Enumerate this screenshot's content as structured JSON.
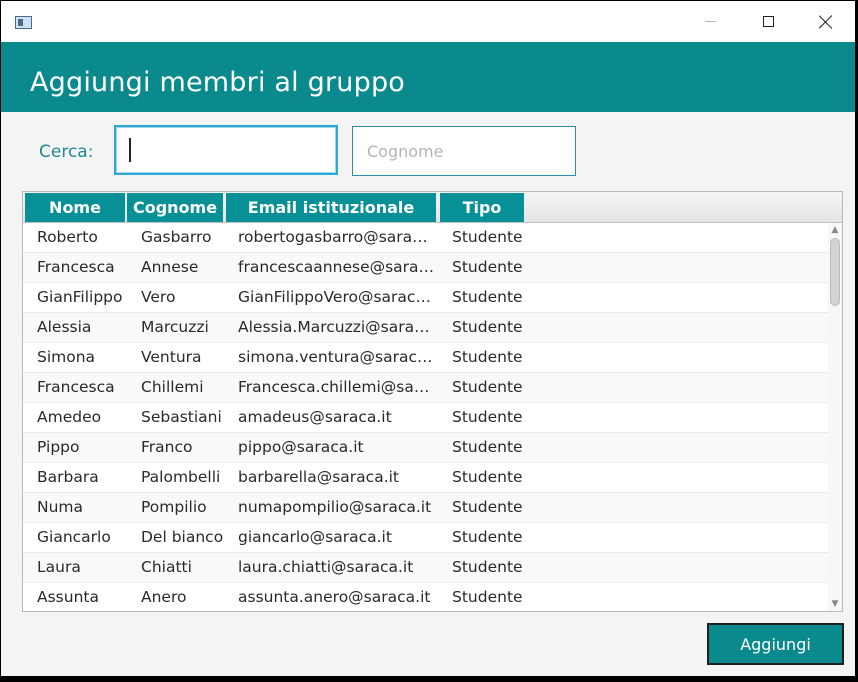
{
  "header": {
    "title": "Aggiungi membri al gruppo"
  },
  "search": {
    "label": "Cerca:",
    "name_value": "",
    "surname_placeholder": "Cognome"
  },
  "table": {
    "columns": [
      "Nome",
      "Cognome",
      "Email istituzionale",
      "Tipo"
    ],
    "rows": [
      {
        "nome": "Roberto",
        "cognome": "Gasbarro",
        "email": "robertogasbarro@saraca.it",
        "tipo": "Studente"
      },
      {
        "nome": "Francesca",
        "cognome": "Annese",
        "email": "francescaannese@saraca.it",
        "tipo": "Studente"
      },
      {
        "nome": "GianFilippo",
        "cognome": "Vero",
        "email": "GianFilippoVero@saraca.it",
        "tipo": "Studente"
      },
      {
        "nome": "Alessia",
        "cognome": "Marcuzzi",
        "email": "Alessia.Marcuzzi@saraca.it",
        "tipo": "Studente"
      },
      {
        "nome": "Simona",
        "cognome": "Ventura",
        "email": "simona.ventura@saraca.it",
        "tipo": "Studente"
      },
      {
        "nome": "Francesca",
        "cognome": "Chillemi",
        "email": "Francesca.chillemi@saraca.it",
        "tipo": "Studente"
      },
      {
        "nome": "Amedeo",
        "cognome": "Sebastiani",
        "email": "amadeus@saraca.it",
        "tipo": "Studente"
      },
      {
        "nome": "Pippo",
        "cognome": "Franco",
        "email": "pippo@saraca.it",
        "tipo": "Studente"
      },
      {
        "nome": "Barbara",
        "cognome": "Palombelli",
        "email": "barbarella@saraca.it",
        "tipo": "Studente"
      },
      {
        "nome": "Numa",
        "cognome": "Pompilio",
        "email": "numapompilio@saraca.it",
        "tipo": "Studente"
      },
      {
        "nome": "Giancarlo",
        "cognome": "Del bianco",
        "email": "giancarlo@saraca.it",
        "tipo": "Studente"
      },
      {
        "nome": "Laura",
        "cognome": "Chiatti",
        "email": "laura.chiatti@saraca.it",
        "tipo": "Studente"
      },
      {
        "nome": "Assunta",
        "cognome": "Anero",
        "email": "assunta.anero@saraca.it",
        "tipo": "Studente"
      }
    ]
  },
  "actions": {
    "add_label": "Aggiungi"
  },
  "colors": {
    "accent": "#0a8a8c",
    "header_cell": "#079196",
    "field_border": "#2a8fa6",
    "focus_border": "#2da7d6",
    "label_text": "#1a8a8c"
  },
  "icons": {
    "app": "app-window-icon",
    "minimize": "minimize-icon",
    "maximize": "maximize-icon",
    "close": "close-icon",
    "scroll_up": "chevron-up-icon",
    "scroll_down": "chevron-down-icon"
  }
}
